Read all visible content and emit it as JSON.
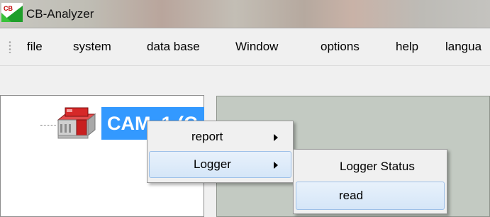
{
  "window": {
    "icon": "cb-analyzer-app-icon",
    "icon_text": "CB",
    "title": "CB-Analyzer"
  },
  "menubar": {
    "items": [
      {
        "label": "file"
      },
      {
        "label": "system"
      },
      {
        "label": "data base"
      },
      {
        "label": "Window"
      },
      {
        "label": "options"
      },
      {
        "label": "help"
      },
      {
        "label": "langua"
      }
    ]
  },
  "tree": {
    "node_icon": "controller-device-icon",
    "node_label": "CAM_1 (C"
  },
  "context_menu": {
    "items": [
      {
        "label": "report",
        "has_submenu": true,
        "highlighted": false
      },
      {
        "label": "Logger",
        "has_submenu": true,
        "highlighted": true
      }
    ]
  },
  "submenu": {
    "items": [
      {
        "label": "Logger Status",
        "highlighted": false
      },
      {
        "label": "read",
        "highlighted": true
      }
    ]
  },
  "colors": {
    "selection": "#3399ff",
    "menu_highlight": "#d5e6f8",
    "mdi_background": "#c3cac2"
  }
}
